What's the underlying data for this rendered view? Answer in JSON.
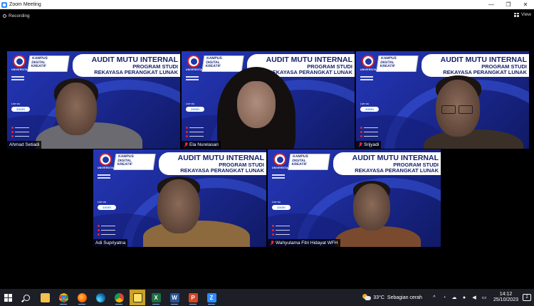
{
  "window": {
    "title": "Zoom Meeting",
    "controls": [
      "—",
      "❐",
      "✕"
    ]
  },
  "top_strip": {
    "recording_label": "Recording",
    "view_label": "View"
  },
  "banner": {
    "university": "UNIVERSITAS",
    "kampus_lines": [
      "KAMPUS",
      "DIGITAL",
      "KREATIF"
    ],
    "title_line1": "AUDIT MUTU INTERNAL",
    "title_line2": "PROGRAM STUDI",
    "title_line3": "REKAYASA PERANGKAT LUNAK",
    "live_via": "Live via",
    "zoom": "zoom"
  },
  "participants": [
    {
      "name": "Ahmad Setiadi",
      "muted": false,
      "active": false
    },
    {
      "name": "Ela Nurelasari",
      "muted": true,
      "active": false
    },
    {
      "name": "Srijyadi",
      "muted": true,
      "active": false
    },
    {
      "name": "Adi Supriyatna",
      "muted": false,
      "active": true
    },
    {
      "name": "Wahyutama Fitri Hidayat WFH",
      "muted": true,
      "active": false
    }
  ],
  "taskbar": {
    "apps": [
      "start",
      "search",
      "file-explorer",
      "chrome",
      "firefox",
      "edge",
      "chrome-2",
      "sticky-notes",
      "excel",
      "word",
      "powerpoint",
      "zoom"
    ],
    "weather_temp": "33°C",
    "weather_desc": "Sebagian cerah",
    "time": "14:12",
    "date": "25/10/2023",
    "notifications": "2"
  },
  "colors": {
    "active_speaker": "#c9e335",
    "banner_blue": "#1c2a95",
    "zoom_blue": "#2d8cff",
    "muted_red": "#e22233"
  }
}
